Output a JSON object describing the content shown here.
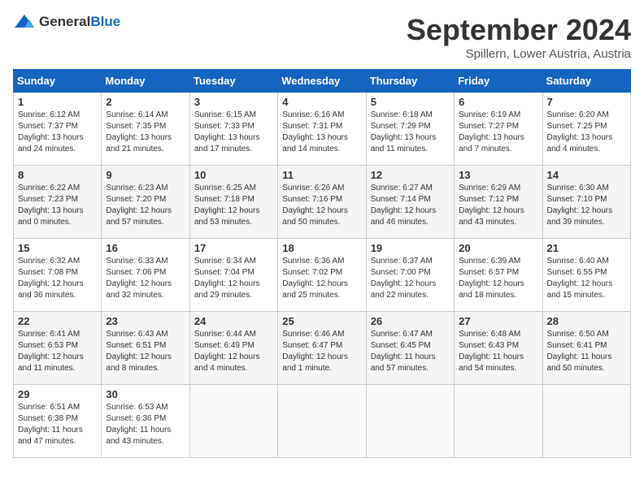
{
  "header": {
    "logo_general": "General",
    "logo_blue": "Blue",
    "title": "September 2024",
    "subtitle": "Spillern, Lower Austria, Austria"
  },
  "weekdays": [
    "Sunday",
    "Monday",
    "Tuesday",
    "Wednesday",
    "Thursday",
    "Friday",
    "Saturday"
  ],
  "weeks": [
    [
      {
        "day": "1",
        "info": "Sunrise: 6:12 AM\nSunset: 7:37 PM\nDaylight: 13 hours\nand 24 minutes."
      },
      {
        "day": "2",
        "info": "Sunrise: 6:14 AM\nSunset: 7:35 PM\nDaylight: 13 hours\nand 21 minutes."
      },
      {
        "day": "3",
        "info": "Sunrise: 6:15 AM\nSunset: 7:33 PM\nDaylight: 13 hours\nand 17 minutes."
      },
      {
        "day": "4",
        "info": "Sunrise: 6:16 AM\nSunset: 7:31 PM\nDaylight: 13 hours\nand 14 minutes."
      },
      {
        "day": "5",
        "info": "Sunrise: 6:18 AM\nSunset: 7:29 PM\nDaylight: 13 hours\nand 11 minutes."
      },
      {
        "day": "6",
        "info": "Sunrise: 6:19 AM\nSunset: 7:27 PM\nDaylight: 13 hours\nand 7 minutes."
      },
      {
        "day": "7",
        "info": "Sunrise: 6:20 AM\nSunset: 7:25 PM\nDaylight: 13 hours\nand 4 minutes."
      }
    ],
    [
      {
        "day": "8",
        "info": "Sunrise: 6:22 AM\nSunset: 7:23 PM\nDaylight: 13 hours\nand 0 minutes."
      },
      {
        "day": "9",
        "info": "Sunrise: 6:23 AM\nSunset: 7:20 PM\nDaylight: 12 hours\nand 57 minutes."
      },
      {
        "day": "10",
        "info": "Sunrise: 6:25 AM\nSunset: 7:18 PM\nDaylight: 12 hours\nand 53 minutes."
      },
      {
        "day": "11",
        "info": "Sunrise: 6:26 AM\nSunset: 7:16 PM\nDaylight: 12 hours\nand 50 minutes."
      },
      {
        "day": "12",
        "info": "Sunrise: 6:27 AM\nSunset: 7:14 PM\nDaylight: 12 hours\nand 46 minutes."
      },
      {
        "day": "13",
        "info": "Sunrise: 6:29 AM\nSunset: 7:12 PM\nDaylight: 12 hours\nand 43 minutes."
      },
      {
        "day": "14",
        "info": "Sunrise: 6:30 AM\nSunset: 7:10 PM\nDaylight: 12 hours\nand 39 minutes."
      }
    ],
    [
      {
        "day": "15",
        "info": "Sunrise: 6:32 AM\nSunset: 7:08 PM\nDaylight: 12 hours\nand 36 minutes."
      },
      {
        "day": "16",
        "info": "Sunrise: 6:33 AM\nSunset: 7:06 PM\nDaylight: 12 hours\nand 32 minutes."
      },
      {
        "day": "17",
        "info": "Sunrise: 6:34 AM\nSunset: 7:04 PM\nDaylight: 12 hours\nand 29 minutes."
      },
      {
        "day": "18",
        "info": "Sunrise: 6:36 AM\nSunset: 7:02 PM\nDaylight: 12 hours\nand 25 minutes."
      },
      {
        "day": "19",
        "info": "Sunrise: 6:37 AM\nSunset: 7:00 PM\nDaylight: 12 hours\nand 22 minutes."
      },
      {
        "day": "20",
        "info": "Sunrise: 6:39 AM\nSunset: 6:57 PM\nDaylight: 12 hours\nand 18 minutes."
      },
      {
        "day": "21",
        "info": "Sunrise: 6:40 AM\nSunset: 6:55 PM\nDaylight: 12 hours\nand 15 minutes."
      }
    ],
    [
      {
        "day": "22",
        "info": "Sunrise: 6:41 AM\nSunset: 6:53 PM\nDaylight: 12 hours\nand 11 minutes."
      },
      {
        "day": "23",
        "info": "Sunrise: 6:43 AM\nSunset: 6:51 PM\nDaylight: 12 hours\nand 8 minutes."
      },
      {
        "day": "24",
        "info": "Sunrise: 6:44 AM\nSunset: 6:49 PM\nDaylight: 12 hours\nand 4 minutes."
      },
      {
        "day": "25",
        "info": "Sunrise: 6:46 AM\nSunset: 6:47 PM\nDaylight: 12 hours\nand 1 minute."
      },
      {
        "day": "26",
        "info": "Sunrise: 6:47 AM\nSunset: 6:45 PM\nDaylight: 11 hours\nand 57 minutes."
      },
      {
        "day": "27",
        "info": "Sunrise: 6:48 AM\nSunset: 6:43 PM\nDaylight: 11 hours\nand 54 minutes."
      },
      {
        "day": "28",
        "info": "Sunrise: 6:50 AM\nSunset: 6:41 PM\nDaylight: 11 hours\nand 50 minutes."
      }
    ],
    [
      {
        "day": "29",
        "info": "Sunrise: 6:51 AM\nSunset: 6:38 PM\nDaylight: 11 hours\nand 47 minutes."
      },
      {
        "day": "30",
        "info": "Sunrise: 6:53 AM\nSunset: 6:36 PM\nDaylight: 11 hours\nand 43 minutes."
      },
      {
        "day": "",
        "info": ""
      },
      {
        "day": "",
        "info": ""
      },
      {
        "day": "",
        "info": ""
      },
      {
        "day": "",
        "info": ""
      },
      {
        "day": "",
        "info": ""
      }
    ]
  ]
}
